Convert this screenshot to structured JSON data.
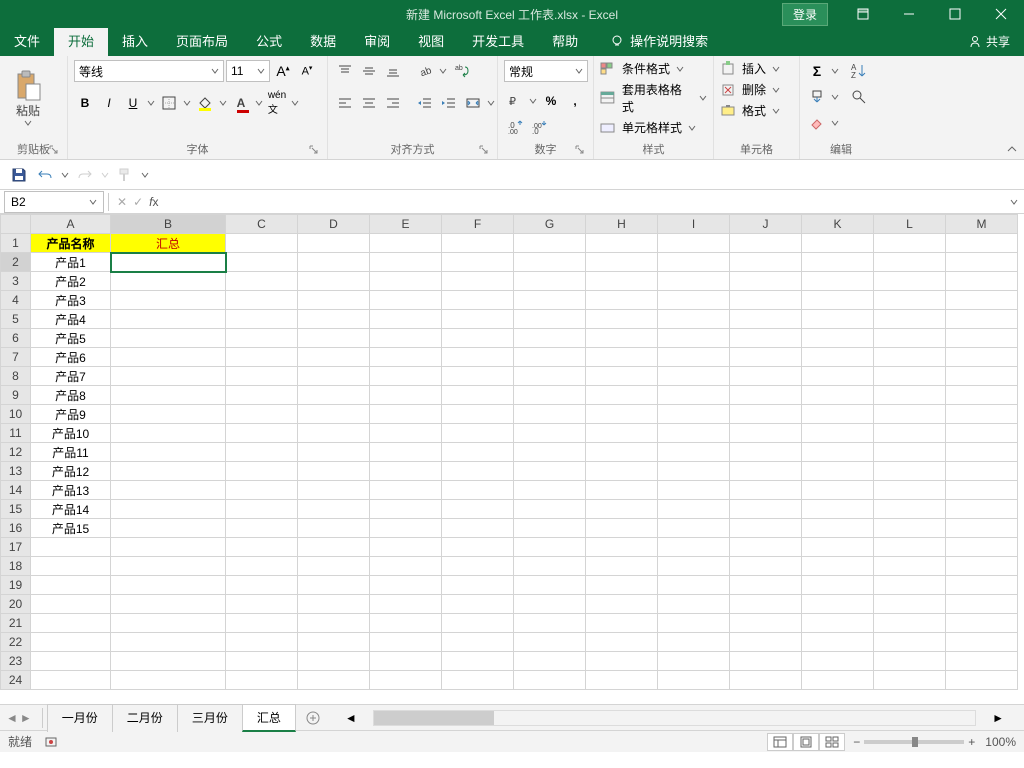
{
  "title": "新建 Microsoft Excel 工作表.xlsx  -  Excel",
  "login": "登录",
  "share": "共享",
  "menu": {
    "file": "文件",
    "home": "开始",
    "insert": "插入",
    "layout": "页面布局",
    "formulas": "公式",
    "data": "数据",
    "review": "审阅",
    "view": "视图",
    "dev": "开发工具",
    "help": "帮助",
    "tell": "操作说明搜索"
  },
  "ribbon": {
    "clipboard": {
      "label": "剪贴板",
      "paste": "粘贴"
    },
    "font": {
      "label": "字体",
      "name": "等线",
      "size": "11"
    },
    "align": {
      "label": "对齐方式"
    },
    "number": {
      "label": "数字",
      "fmt": "常规"
    },
    "styles": {
      "label": "样式",
      "cond": "条件格式",
      "tablefmt": "套用表格格式",
      "cellfmt": "单元格样式"
    },
    "cells": {
      "label": "单元格",
      "insert": "插入",
      "delete": "删除",
      "format": "格式"
    },
    "editing": {
      "label": "编辑"
    }
  },
  "namebox": "B2",
  "columns": [
    "A",
    "B",
    "C",
    "D",
    "E",
    "F",
    "G",
    "H",
    "I",
    "J",
    "K",
    "L",
    "M"
  ],
  "colw": {
    "A": 80,
    "B": 115,
    "default": 72
  },
  "rows": [
    {
      "n": 1,
      "cells": {
        "A": {
          "v": "产品名称",
          "y": true,
          "bold": true
        },
        "B": {
          "v": "汇总",
          "y": true,
          "red": true
        }
      }
    },
    {
      "n": 2,
      "cells": {
        "A": {
          "v": "产品1"
        },
        "B": {
          "v": "",
          "sel": true
        }
      }
    },
    {
      "n": 3,
      "cells": {
        "A": {
          "v": "产品2"
        }
      }
    },
    {
      "n": 4,
      "cells": {
        "A": {
          "v": "产品3"
        }
      }
    },
    {
      "n": 5,
      "cells": {
        "A": {
          "v": "产品4"
        }
      }
    },
    {
      "n": 6,
      "cells": {
        "A": {
          "v": "产品5"
        }
      }
    },
    {
      "n": 7,
      "cells": {
        "A": {
          "v": "产品6"
        }
      }
    },
    {
      "n": 8,
      "cells": {
        "A": {
          "v": "产品7"
        }
      }
    },
    {
      "n": 9,
      "cells": {
        "A": {
          "v": "产品8"
        }
      }
    },
    {
      "n": 10,
      "cells": {
        "A": {
          "v": "产品9"
        }
      }
    },
    {
      "n": 11,
      "cells": {
        "A": {
          "v": "产品10"
        }
      }
    },
    {
      "n": 12,
      "cells": {
        "A": {
          "v": "产品11"
        }
      }
    },
    {
      "n": 13,
      "cells": {
        "A": {
          "v": "产品12"
        }
      }
    },
    {
      "n": 14,
      "cells": {
        "A": {
          "v": "产品13"
        }
      }
    },
    {
      "n": 15,
      "cells": {
        "A": {
          "v": "产品14"
        }
      }
    },
    {
      "n": 16,
      "cells": {
        "A": {
          "v": "产品15"
        }
      }
    },
    {
      "n": 17,
      "cells": {}
    },
    {
      "n": 18,
      "cells": {}
    },
    {
      "n": 19,
      "cells": {}
    },
    {
      "n": 20,
      "cells": {}
    },
    {
      "n": 21,
      "cells": {}
    },
    {
      "n": 22,
      "cells": {}
    },
    {
      "n": 23,
      "cells": {}
    },
    {
      "n": 24,
      "cells": {}
    }
  ],
  "sheets": [
    "一月份",
    "二月份",
    "三月份",
    "汇总"
  ],
  "activeSheet": "汇总",
  "status": {
    "ready": "就绪",
    "zoom": "100%"
  }
}
